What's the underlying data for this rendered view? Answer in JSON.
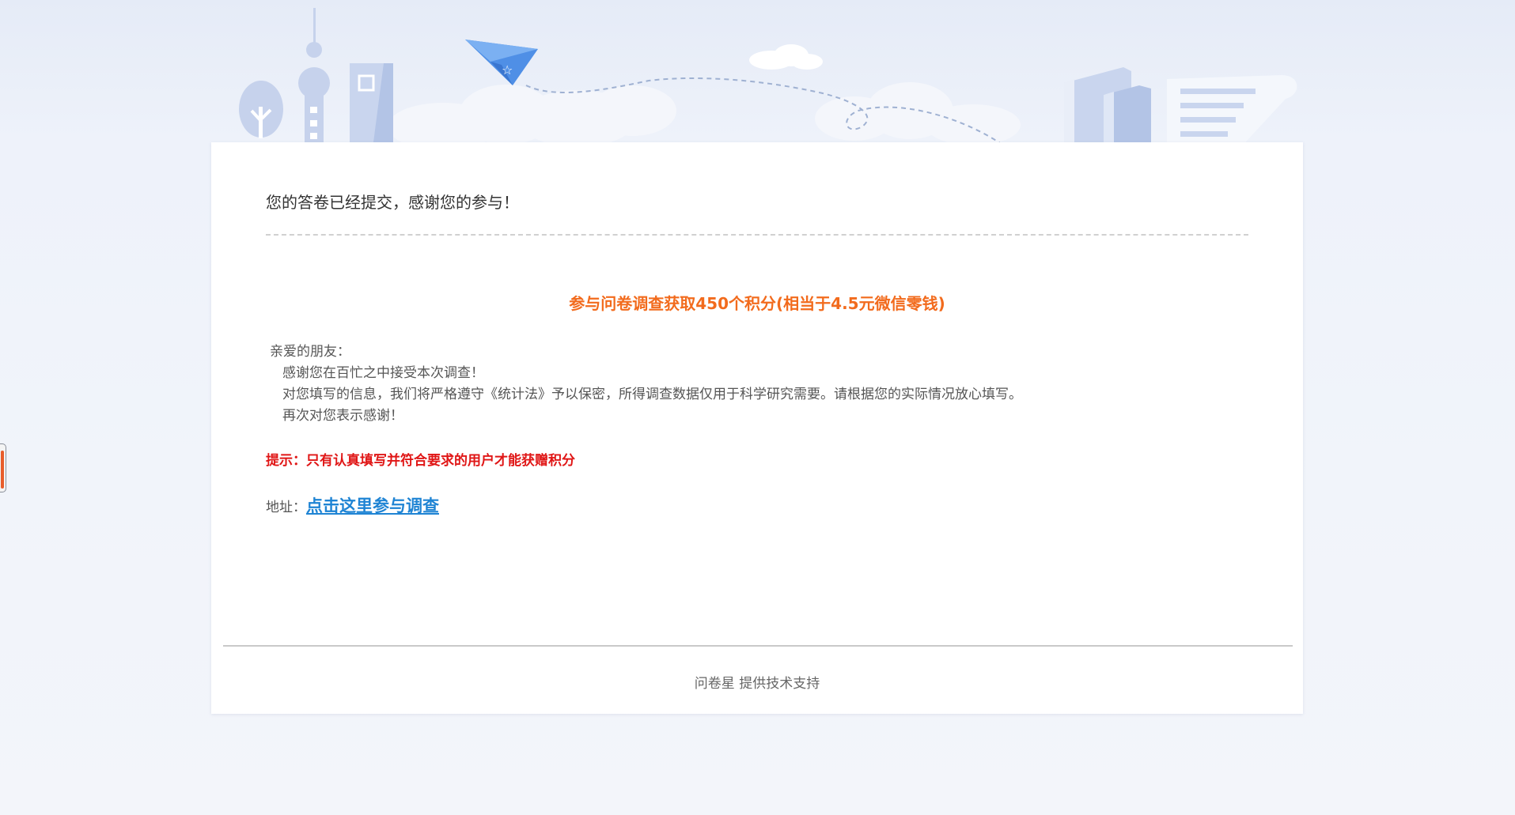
{
  "survey": {
    "submitted_message": "您的答卷已经提交，感谢您的参与！",
    "reward_heading": "参与问卷调查获取450个积分(相当于4.5元微信零钱)",
    "letter": {
      "greeting": "亲爱的朋友：",
      "line1": "感谢您在百忙之中接受本次调查！",
      "line2": "对您填写的信息，我们将严格遵守《统计法》予以保密，所得调查数据仅用于科学研究需要。请根据您的实际情况放心填写。",
      "line3": "再次对您表示感谢！"
    },
    "tip_notice": "提示：只有认真填写并符合要求的用户才能获赠积分",
    "address_label": "地址：",
    "participate_link": "点击这里参与调查"
  },
  "footer": {
    "credit": "问卷星 提供技术支持"
  },
  "colors": {
    "accent_orange": "#f26b1d",
    "warning_red": "#e01616",
    "link_blue": "#1f84d4",
    "banner_blue": "#c5d3ee"
  }
}
